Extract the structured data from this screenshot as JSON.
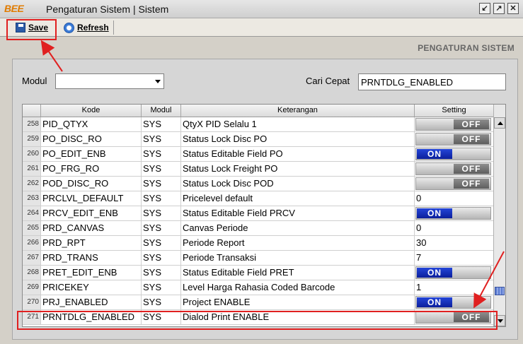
{
  "window": {
    "logo": "BEE",
    "title": "Pengaturan Sistem | Sistem",
    "controls": [
      "restore-icon",
      "maximize-icon",
      "close-icon"
    ]
  },
  "toolbar": {
    "save_label": "Save",
    "refresh_label": "Refresh"
  },
  "section_title": "PENGATURAN SISTEM",
  "filters": {
    "modul_label": "Modul",
    "modul_value": "",
    "cari_label": "Cari Cepat",
    "cari_value": "PRNTDLG_ENABLED"
  },
  "grid": {
    "columns": [
      "Kode",
      "Modul",
      "Keterangan",
      "Setting"
    ],
    "rows": [
      {
        "no": "258",
        "kode": "PID_QTYX",
        "modul": "SYS",
        "ket": "QtyX PID Selalu 1",
        "setting": {
          "type": "toggle",
          "value": "OFF"
        }
      },
      {
        "no": "259",
        "kode": "PO_DISC_RO",
        "modul": "SYS",
        "ket": "Status Lock Disc PO",
        "setting": {
          "type": "toggle",
          "value": "OFF"
        }
      },
      {
        "no": "260",
        "kode": "PO_EDIT_ENB",
        "modul": "SYS",
        "ket": "Status Editable Field PO",
        "setting": {
          "type": "toggle",
          "value": "ON"
        }
      },
      {
        "no": "261",
        "kode": "PO_FRG_RO",
        "modul": "SYS",
        "ket": "Status Lock Freight PO",
        "setting": {
          "type": "toggle",
          "value": "OFF"
        }
      },
      {
        "no": "262",
        "kode": "POD_DISC_RO",
        "modul": "SYS",
        "ket": "Status Lock Disc POD",
        "setting": {
          "type": "toggle",
          "value": "OFF"
        }
      },
      {
        "no": "263",
        "kode": "PRCLVL_DEFAULT",
        "modul": "SYS",
        "ket": "Pricelevel default",
        "setting": {
          "type": "text",
          "value": "0"
        }
      },
      {
        "no": "264",
        "kode": "PRCV_EDIT_ENB",
        "modul": "SYS",
        "ket": "Status Editable Field PRCV",
        "setting": {
          "type": "toggle",
          "value": "ON"
        }
      },
      {
        "no": "265",
        "kode": "PRD_CANVAS",
        "modul": "SYS",
        "ket": "Canvas Periode",
        "setting": {
          "type": "text",
          "value": "0"
        }
      },
      {
        "no": "266",
        "kode": "PRD_RPT",
        "modul": "SYS",
        "ket": "Periode Report",
        "setting": {
          "type": "text",
          "value": "30"
        }
      },
      {
        "no": "267",
        "kode": "PRD_TRANS",
        "modul": "SYS",
        "ket": "Periode Transaksi",
        "setting": {
          "type": "text",
          "value": "7"
        }
      },
      {
        "no": "268",
        "kode": "PRET_EDIT_ENB",
        "modul": "SYS",
        "ket": "Status Editable Field PRET",
        "setting": {
          "type": "toggle",
          "value": "ON"
        }
      },
      {
        "no": "269",
        "kode": "PRICEKEY",
        "modul": "SYS",
        "ket": "Level Harga Rahasia Coded Barcode",
        "setting": {
          "type": "text",
          "value": "1"
        }
      },
      {
        "no": "270",
        "kode": "PRJ_ENABLED",
        "modul": "SYS",
        "ket": "Project ENABLE",
        "setting": {
          "type": "toggle",
          "value": "ON"
        }
      },
      {
        "no": "271",
        "kode": "PRNTDLG_ENABLED",
        "modul": "SYS",
        "ket": "Dialod Print ENABLE",
        "setting": {
          "type": "toggle",
          "value": "OFF"
        }
      }
    ]
  },
  "colors": {
    "annotation_red": "#e02020",
    "toggle_on": "#1a33c0",
    "toggle_off": "#6e6e6e"
  }
}
